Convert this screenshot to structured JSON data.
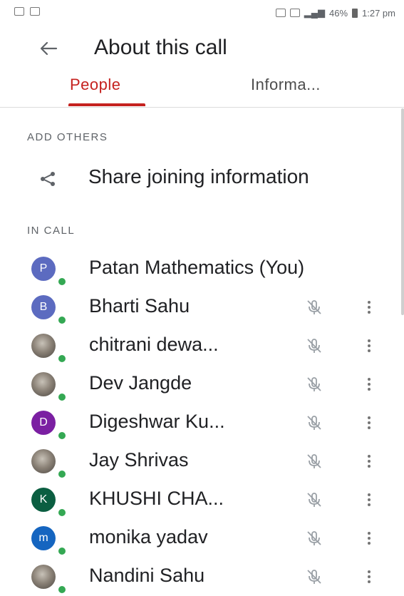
{
  "status_bar": {
    "battery": "46%",
    "time": "1:27 pm"
  },
  "app_bar": {
    "title": "About this call",
    "back_icon": "arrow-back-icon"
  },
  "tabs": [
    {
      "label": "People",
      "active": true
    },
    {
      "label": "Informa..."
    }
  ],
  "accent_color": "#c5221f",
  "add_others": {
    "label": "ADD OTHERS",
    "share_label": "Share joining information",
    "share_icon": "share-icon"
  },
  "in_call": {
    "label": "IN CALL",
    "participants": [
      {
        "name": "Patan Mathematics (You)",
        "initial": "P",
        "avatar_color": "#5c6bc0"
      },
      {
        "name": "Bharti Sahu",
        "initial": "B",
        "avatar_color": "#5c6bc0"
      },
      {
        "name": "chitrani dewa...",
        "initial": ""
      },
      {
        "name": "Dev Jangde",
        "initial": ""
      },
      {
        "name": "Digeshwar Ku...",
        "initial": "D",
        "avatar_color": "#7b1fa2"
      },
      {
        "name": "Jay Shrivas",
        "initial": ""
      },
      {
        "name": "KHUSHI CHA...",
        "initial": "K",
        "avatar_color": "#0b5e41"
      },
      {
        "name": "monika yadav",
        "initial": "m",
        "avatar_color": "#1565c0"
      },
      {
        "name": "Nandini Sahu",
        "initial": ""
      }
    ]
  }
}
